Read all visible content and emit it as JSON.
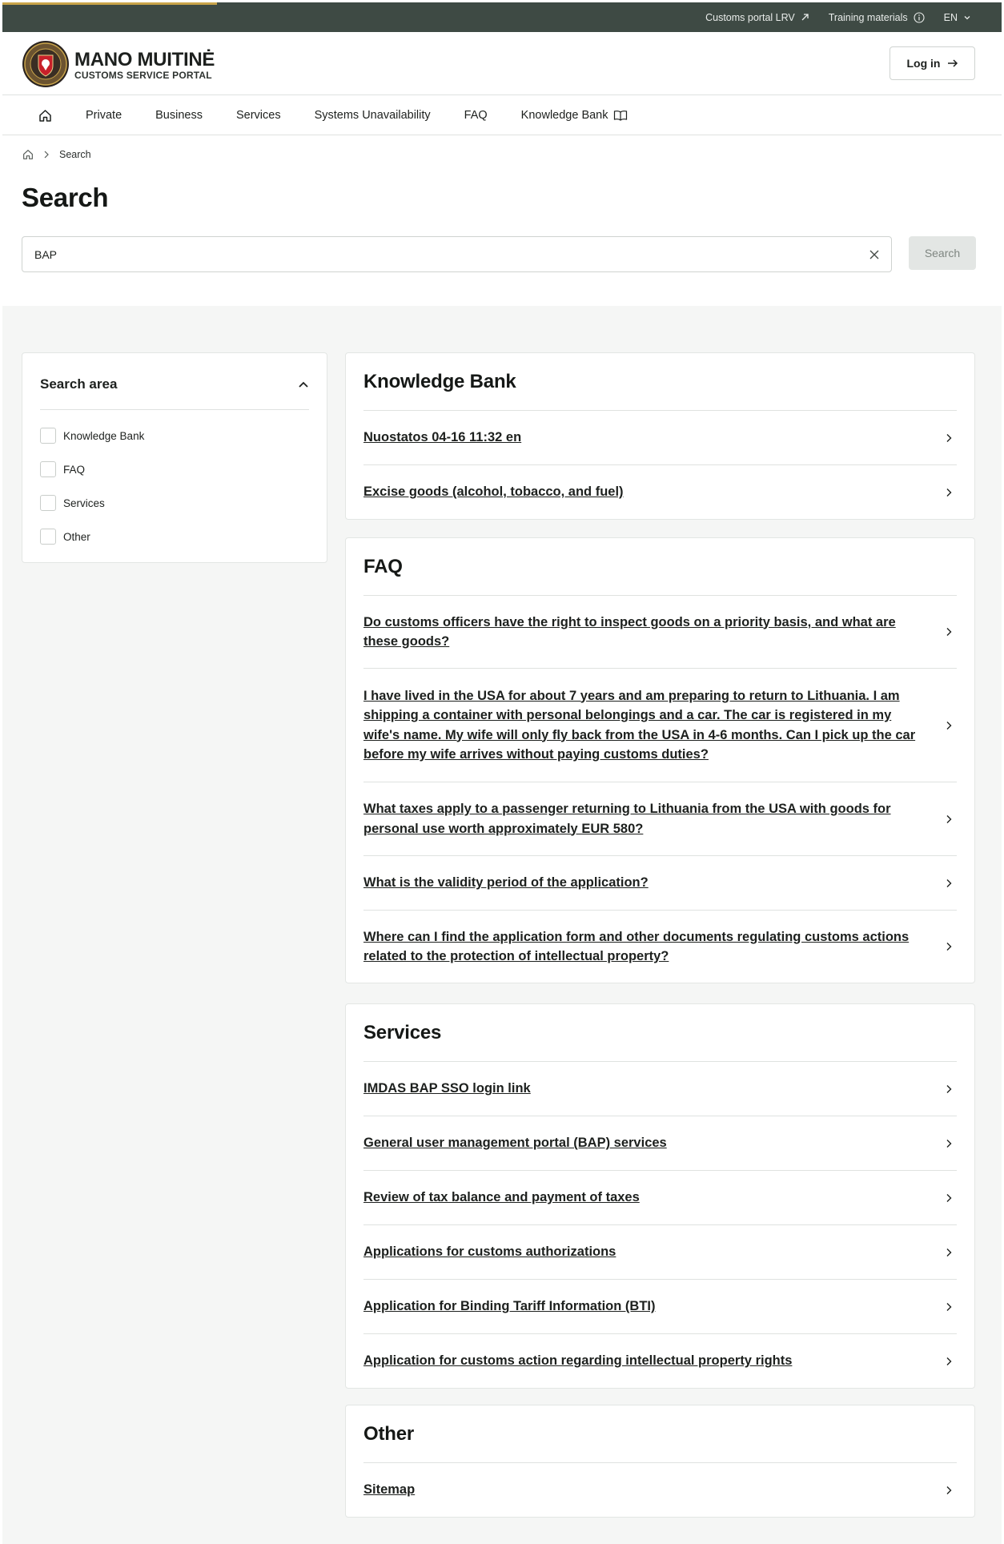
{
  "topbar": {
    "customs_portal": "Customs portal LRV",
    "training": "Training materials",
    "language": "EN"
  },
  "brand": {
    "name": "MANO MUITINĖ",
    "subtitle": "CUSTOMS SERVICE PORTAL",
    "login_label": "Log in"
  },
  "nav": {
    "items": [
      "Private",
      "Business",
      "Services",
      "Systems Unavailability",
      "FAQ",
      "Knowledge Bank"
    ]
  },
  "breadcrumb": {
    "current": "Search"
  },
  "page": {
    "title": "Search"
  },
  "search": {
    "value": "BAP",
    "button_label": "Search"
  },
  "filter": {
    "title": "Search area",
    "options": [
      "Knowledge Bank",
      "FAQ",
      "Services",
      "Other"
    ]
  },
  "groups": {
    "knowledge_bank": {
      "title": "Knowledge Bank",
      "items": [
        "Nuostatos 04-16 11:32 en",
        "Excise goods (alcohol, tobacco, and fuel)"
      ]
    },
    "faq": {
      "title": "FAQ",
      "items": [
        "Do customs officers have the right to inspect goods on a priority basis, and what are these goods?",
        "I have lived in the USA for about 7 years and am preparing to return to Lithuania. I am shipping a container with personal belongings and a car. The car is registered in my wife's name. My wife will only fly back from the USA in 4-6 months. Can I pick up the car before my wife arrives without paying customs duties?",
        "What taxes apply to a passenger returning to Lithuania from the USA with goods for personal use worth approximately EUR 580?",
        "What is the validity period of the application?",
        "Where can I find the application form and other documents regulating customs actions related to the protection of intellectual property?"
      ]
    },
    "services": {
      "title": "Services",
      "items": [
        "IMDAS BAP SSO login link",
        "General user management portal (BAP) services",
        "Review of tax balance and payment of taxes",
        "Applications for customs authorizations",
        "Application for Binding Tariff Information (BTI)",
        "Application for customs action regarding intellectual property rights"
      ]
    },
    "other": {
      "title": "Other",
      "items": [
        "Sitemap"
      ]
    }
  }
}
